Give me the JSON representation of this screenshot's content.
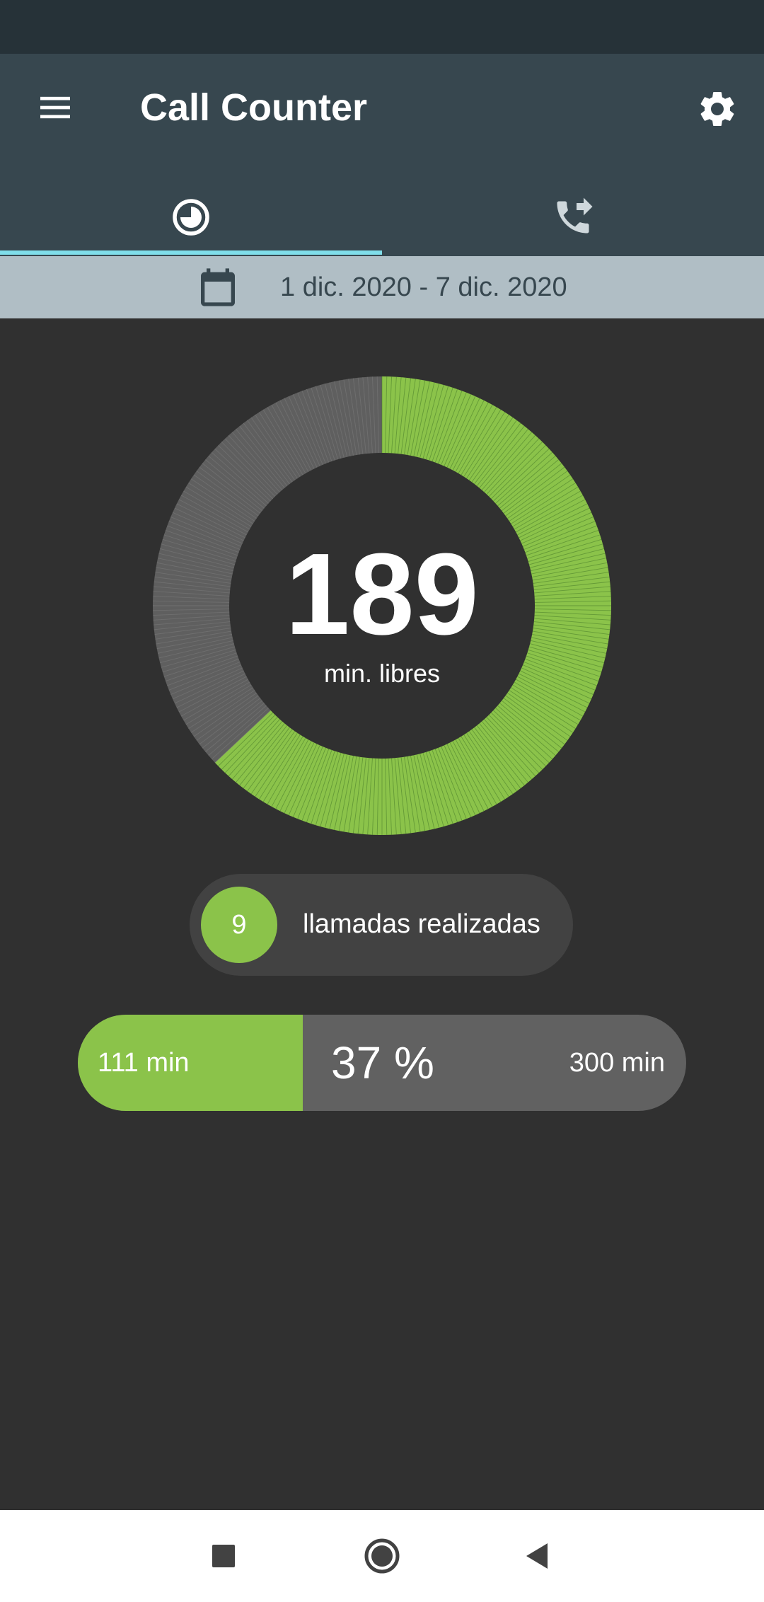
{
  "app": {
    "title": "Call Counter"
  },
  "icons": {
    "menu": "menu-icon",
    "settings": "gear-icon",
    "tab_usage": "pie-chart-icon",
    "tab_calls": "phone-forwarded-icon",
    "date": "calendar-icon",
    "nav_recents": "square-icon",
    "nav_home": "circle-icon",
    "nav_back": "triangle-back-icon"
  },
  "tabs": [
    {
      "name": "usage",
      "selected": true
    },
    {
      "name": "calls",
      "selected": false
    }
  ],
  "date_range": {
    "label": "1 dic. 2020 - 7 dic. 2020"
  },
  "summary": {
    "free_minutes": "189",
    "free_label": "min. libres",
    "calls_count": "9",
    "calls_label": "llamadas realizadas",
    "used_label": "111 min",
    "percent_label": "37 %",
    "total_label": "300 min"
  },
  "usage": {
    "used_minutes": 111,
    "total_minutes": 300,
    "free_minutes": 189,
    "used_fraction": 0.37
  },
  "colors": {
    "accent_green": "#8bc34a",
    "remaining_grey": "#5f5f5f",
    "app_bar": "#37474f",
    "tab_indicator": "#80deea",
    "date_bar": "#b0bec5",
    "background": "#303030"
  }
}
